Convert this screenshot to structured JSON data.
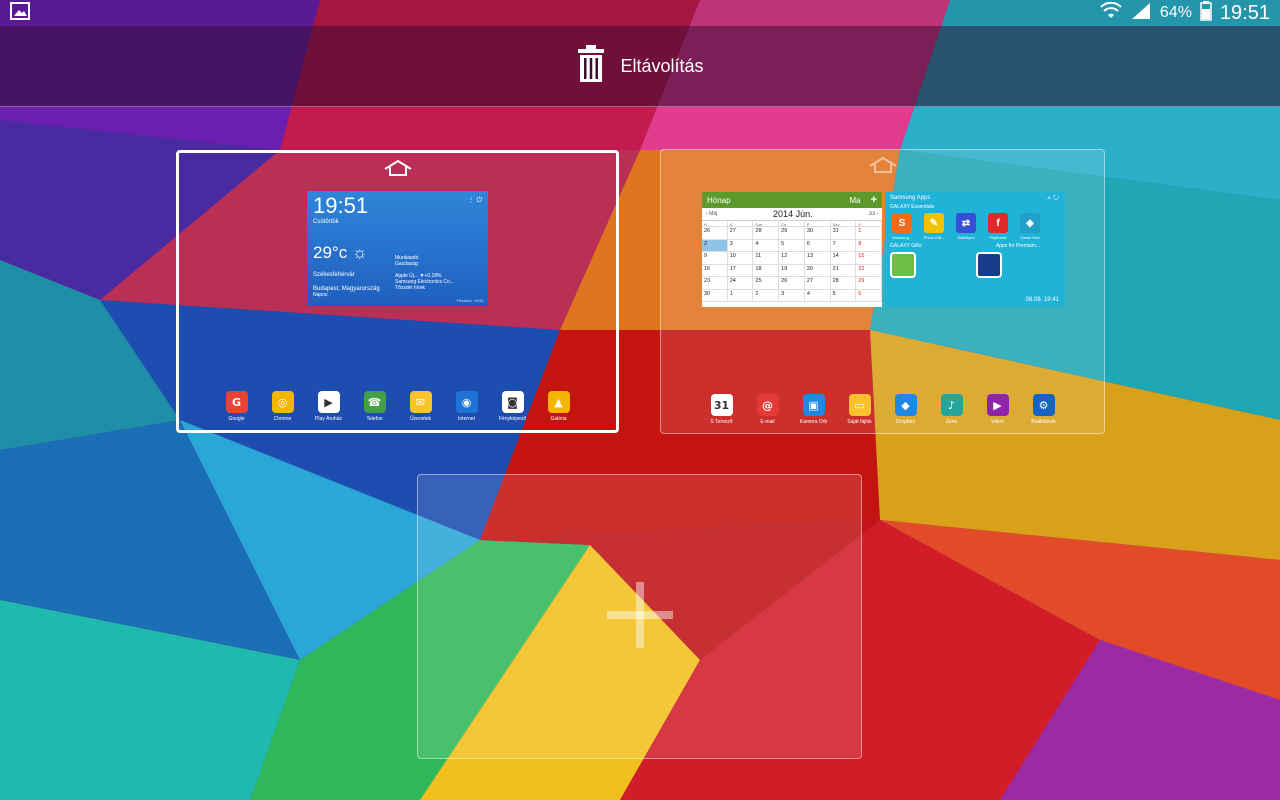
{
  "status_bar": {
    "battery": "64%",
    "time": "19:51",
    "icons": [
      "gallery-icon",
      "wifi-icon",
      "signal-icon",
      "battery-icon"
    ]
  },
  "remove_bar": {
    "label": "Eltávolítás",
    "icon": "trash-icon"
  },
  "page1": {
    "weather": {
      "time": "19:51",
      "date": "Csütörtök",
      "temp": "29°c",
      "location": "Székesfehérvár",
      "location2": "Budapest, Magyarország",
      "location3": "Napos",
      "news_title": "Munkaadó",
      "news_sub": "Gazdaság",
      "news2_title": "Apple Új... ▼+0.18%",
      "news2_sub": "Samsung Electronics Co...",
      "news2_sub2": "Tőzsdei hírek",
      "footer": "Frissítve: 19:51"
    },
    "dock": [
      {
        "label": "Google",
        "color": "#e94335",
        "glyph": "G"
      },
      {
        "label": "Chrome",
        "color": "#f2b705",
        "glyph": "◎"
      },
      {
        "label": "Play Áruház",
        "color": "#ffffff",
        "glyph": "▶"
      },
      {
        "label": "Telefon",
        "color": "#43a047",
        "glyph": "☎"
      },
      {
        "label": "Üzenetek",
        "color": "#f9c32b",
        "glyph": "✉"
      },
      {
        "label": "Internet",
        "color": "#1e74d6",
        "glyph": "◉"
      },
      {
        "label": "Fényképező",
        "color": "#ffffff",
        "glyph": "◙"
      },
      {
        "label": "Galéria",
        "color": "#f4b400",
        "glyph": "▲"
      }
    ]
  },
  "page2": {
    "calendar": {
      "view": "Hónap",
      "today_btn": "Ma",
      "prev": "Máj",
      "month": "2014 Jún.",
      "next": "Júl",
      "weekdays": [
        "H",
        "K",
        "Sze",
        "Cs",
        "P",
        "Szo",
        "V"
      ],
      "days": [
        "26",
        "27",
        "28",
        "29",
        "30",
        "31",
        "1",
        "2",
        "3",
        "4",
        "5",
        "6",
        "7",
        "8",
        "9",
        "10",
        "11",
        "12",
        "13",
        "14",
        "15",
        "16",
        "17",
        "18",
        "19",
        "20",
        "21",
        "22",
        "23",
        "24",
        "25",
        "26",
        "27",
        "28",
        "29",
        "30",
        "1",
        "2",
        "3",
        "4",
        "5",
        "6"
      ]
    },
    "samsung_apps": {
      "title": "Samsung Apps",
      "sub1": "GALAXY Essentials",
      "apps": [
        {
          "label": "Samsung...",
          "color": "#f26b1d",
          "glyph": "S"
        },
        {
          "label": "Photo Edi...",
          "color": "#f2c200",
          "glyph": "✎"
        },
        {
          "label": "SideSync",
          "color": "#3550d4",
          "glyph": "⇄"
        },
        {
          "label": "Flipboard",
          "color": "#e12828",
          "glyph": "f"
        },
        {
          "label": "Game Hub",
          "color": "#1fa0c4",
          "glyph": "◈"
        }
      ],
      "sub2": "GALAXY Gifts",
      "sub3": "Apps for Premium...",
      "footer": "06.09. 19:41"
    },
    "dock": [
      {
        "label": "S Tervező",
        "color": "#ffffff",
        "glyph": "31"
      },
      {
        "label": "E-mail",
        "color": "#e53935",
        "glyph": "@"
      },
      {
        "label": "Kamera Orb",
        "color": "#1e88e5",
        "glyph": "▣"
      },
      {
        "label": "Saját fájlok",
        "color": "#fbc02d",
        "glyph": "▭"
      },
      {
        "label": "Dropbox",
        "color": "#1e88e5",
        "glyph": "◆"
      },
      {
        "label": "Zene",
        "color": "#26a69a",
        "glyph": "♪"
      },
      {
        "label": "Videó",
        "color": "#8e24aa",
        "glyph": "▶"
      },
      {
        "label": "Beállítások",
        "color": "#1565c0",
        "glyph": "⚙"
      }
    ]
  },
  "add_page": {
    "icon": "plus-icon"
  }
}
